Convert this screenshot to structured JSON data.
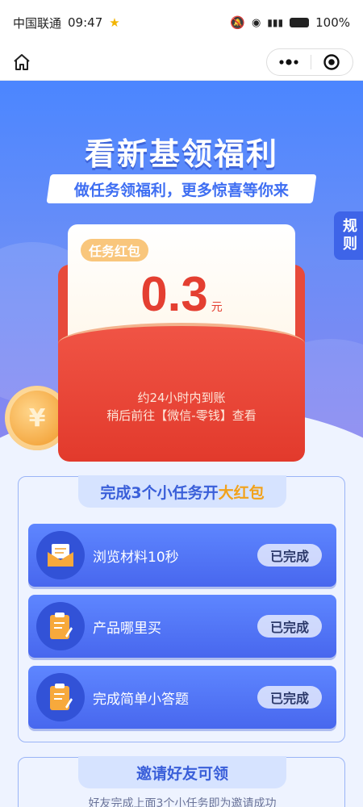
{
  "status_bar": {
    "carrier": "中国联通",
    "time": "09:47",
    "battery": "100%"
  },
  "hero": {
    "title": "看新基领福利",
    "subtitle": "做任务领福利，更多惊喜等你来",
    "rules_tab": "规则"
  },
  "envelope": {
    "tag": "任务红包",
    "amount": "0.3",
    "unit": "元",
    "note_line1": "约24小时内到账",
    "note_line2": "稍后前往【微信-零钱】查看"
  },
  "tasks": {
    "header_prefix": "完成3个小任务开",
    "header_highlight": "大红包",
    "items": [
      {
        "label": "浏览材料10秒",
        "status": "已完成",
        "icon": "envelope-icon"
      },
      {
        "label": "产品哪里买",
        "status": "已完成",
        "icon": "clipboard-icon"
      },
      {
        "label": "完成简单小答题",
        "status": "已完成",
        "icon": "clipboard-icon"
      }
    ]
  },
  "invite": {
    "header": "邀请好友可领",
    "subtext": "好友完成上面3个小任务即为邀请成功"
  },
  "colors": {
    "accent_blue": "#3e6ef2",
    "red_envelope": "#e74a3b",
    "highlight_gold": "#f2a21b"
  }
}
